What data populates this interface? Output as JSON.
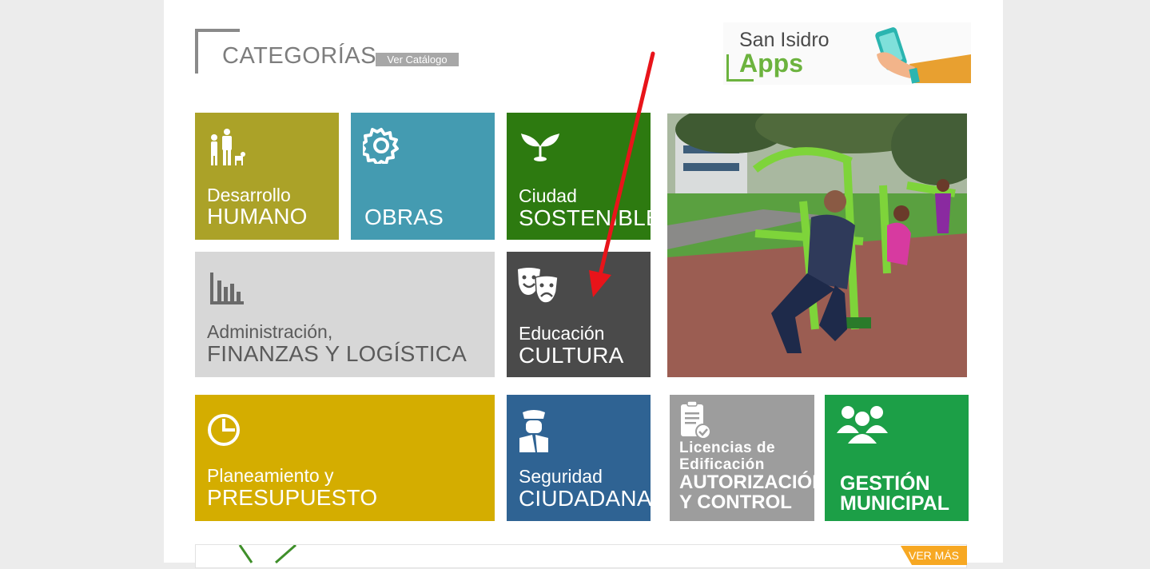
{
  "header": {
    "title": "CATEGORÍAS",
    "catalog_button": "Ver Catálogo"
  },
  "apps_banner": {
    "line1": "San Isidro",
    "line2": "Apps"
  },
  "tiles": [
    {
      "line1": "Desarrollo",
      "line2": "HUMANO",
      "color": "#aba228",
      "icon": "family-icon"
    },
    {
      "line1": "",
      "line2": "OBRAS",
      "color": "#449bb1",
      "icon": "gear-icon"
    },
    {
      "line1": "Ciudad",
      "line2": "SOSTENIBLE",
      "color": "#2d7a10",
      "icon": "sprout-icon"
    },
    {
      "line1": "Administración,",
      "line2": "FINANZAS Y LOGÍSTICA",
      "color": "#d7d7d7",
      "icon": "bar-chart-icon"
    },
    {
      "line1": "Educación",
      "line2": "CULTURA",
      "color": "#4a4a4a",
      "icon": "theater-masks-icon"
    },
    {
      "line1": "Planeamiento y",
      "line2": "PRESUPUESTO",
      "color": "#d4ad00",
      "icon": "pie-clock-icon"
    },
    {
      "line1": "Seguridad",
      "line2": "CIUDADANA",
      "color": "#2f6393",
      "icon": "security-officer-icon"
    },
    {
      "line1": "Licencias de",
      "line1b": "Edificación",
      "line2": "AUTORIZACIÓN",
      "line2b": "Y CONTROL",
      "color": "#9d9d9d",
      "icon": "clipboard-check-icon"
    },
    {
      "line1": "GESTIÓN",
      "line2": "MUNICIPAL",
      "color": "#1c9f47",
      "icon": "people-group-icon"
    }
  ],
  "photo": {
    "icon": "park-exercise-photo"
  },
  "footer": {
    "ver_mas": "VER MÁS"
  }
}
